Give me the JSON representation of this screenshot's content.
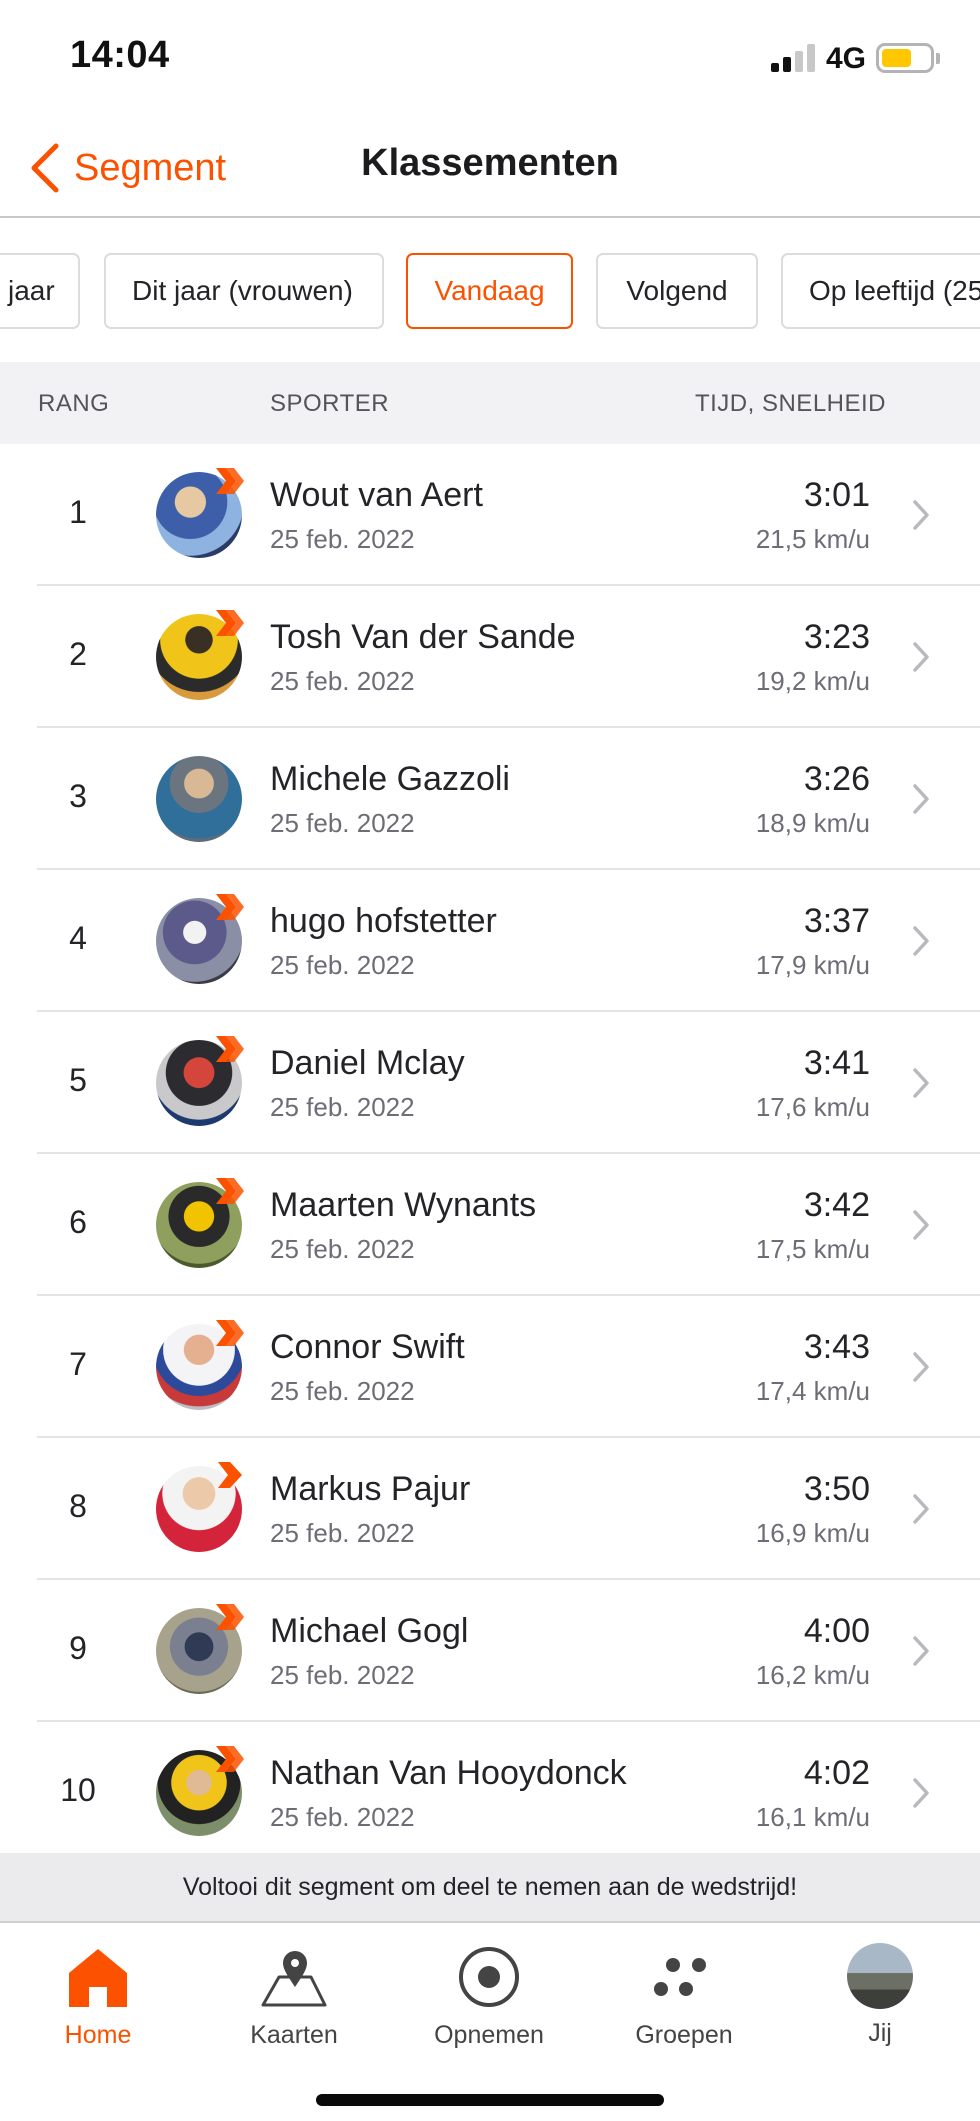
{
  "status_bar": {
    "time": "14:04",
    "network": "4G"
  },
  "nav": {
    "back_label": "Segment",
    "title": "Klassementen"
  },
  "filters": [
    {
      "label": "jaar"
    },
    {
      "label": "Dit jaar (vrouwen)"
    },
    {
      "label": "Vandaag",
      "active": true
    },
    {
      "label": "Volgend"
    },
    {
      "label": "Op leeftijd (25"
    }
  ],
  "table_header": {
    "rank": "RANG",
    "athlete": "SPORTER",
    "time": "TIJD, SNELHEID"
  },
  "leaderboard": [
    {
      "rank": "1",
      "name": "Wout van Aert",
      "date": "25 feb. 2022",
      "time": "3:01",
      "speed": "21,5 km/u",
      "subscriber": true
    },
    {
      "rank": "2",
      "name": "Tosh Van der Sande",
      "date": "25 feb. 2022",
      "time": "3:23",
      "speed": "19,2 km/u",
      "subscriber": true
    },
    {
      "rank": "3",
      "name": "Michele Gazzoli",
      "date": "25 feb. 2022",
      "time": "3:26",
      "speed": "18,9 km/u",
      "subscriber": false
    },
    {
      "rank": "4",
      "name": "hugo hofstetter",
      "date": "25 feb. 2022",
      "time": "3:37",
      "speed": "17,9 km/u",
      "subscriber": true
    },
    {
      "rank": "5",
      "name": "Daniel Mclay",
      "date": "25 feb. 2022",
      "time": "3:41",
      "speed": "17,6 km/u",
      "subscriber": true
    },
    {
      "rank": "6",
      "name": "Maarten Wynants",
      "date": "25 feb. 2022",
      "time": "3:42",
      "speed": "17,5 km/u",
      "subscriber": true
    },
    {
      "rank": "7",
      "name": "Connor Swift",
      "date": "25 feb. 2022",
      "time": "3:43",
      "speed": "17,4 km/u",
      "subscriber": true
    },
    {
      "rank": "8",
      "name": "Markus Pajur",
      "date": "25 feb. 2022",
      "time": "3:50",
      "speed": "16,9 km/u",
      "subscriber": true
    },
    {
      "rank": "9",
      "name": "Michael  Gogl",
      "date": "25 feb. 2022",
      "time": "4:00",
      "speed": "16,2 km/u",
      "subscriber": true
    },
    {
      "rank": "10",
      "name": "Nathan Van Hooydonck",
      "date": "25 feb. 2022",
      "time": "4:02",
      "speed": "16,1 km/u",
      "subscriber": true
    }
  ],
  "banner": "Voltooi dit segment om deel te nemen aan de wedstrijd!",
  "tabbar": {
    "home": "Home",
    "maps": "Kaarten",
    "record": "Opnemen",
    "groups": "Groepen",
    "you": "Jij"
  },
  "colors": {
    "accent": "#fc5200",
    "battery": "#ffc700"
  }
}
